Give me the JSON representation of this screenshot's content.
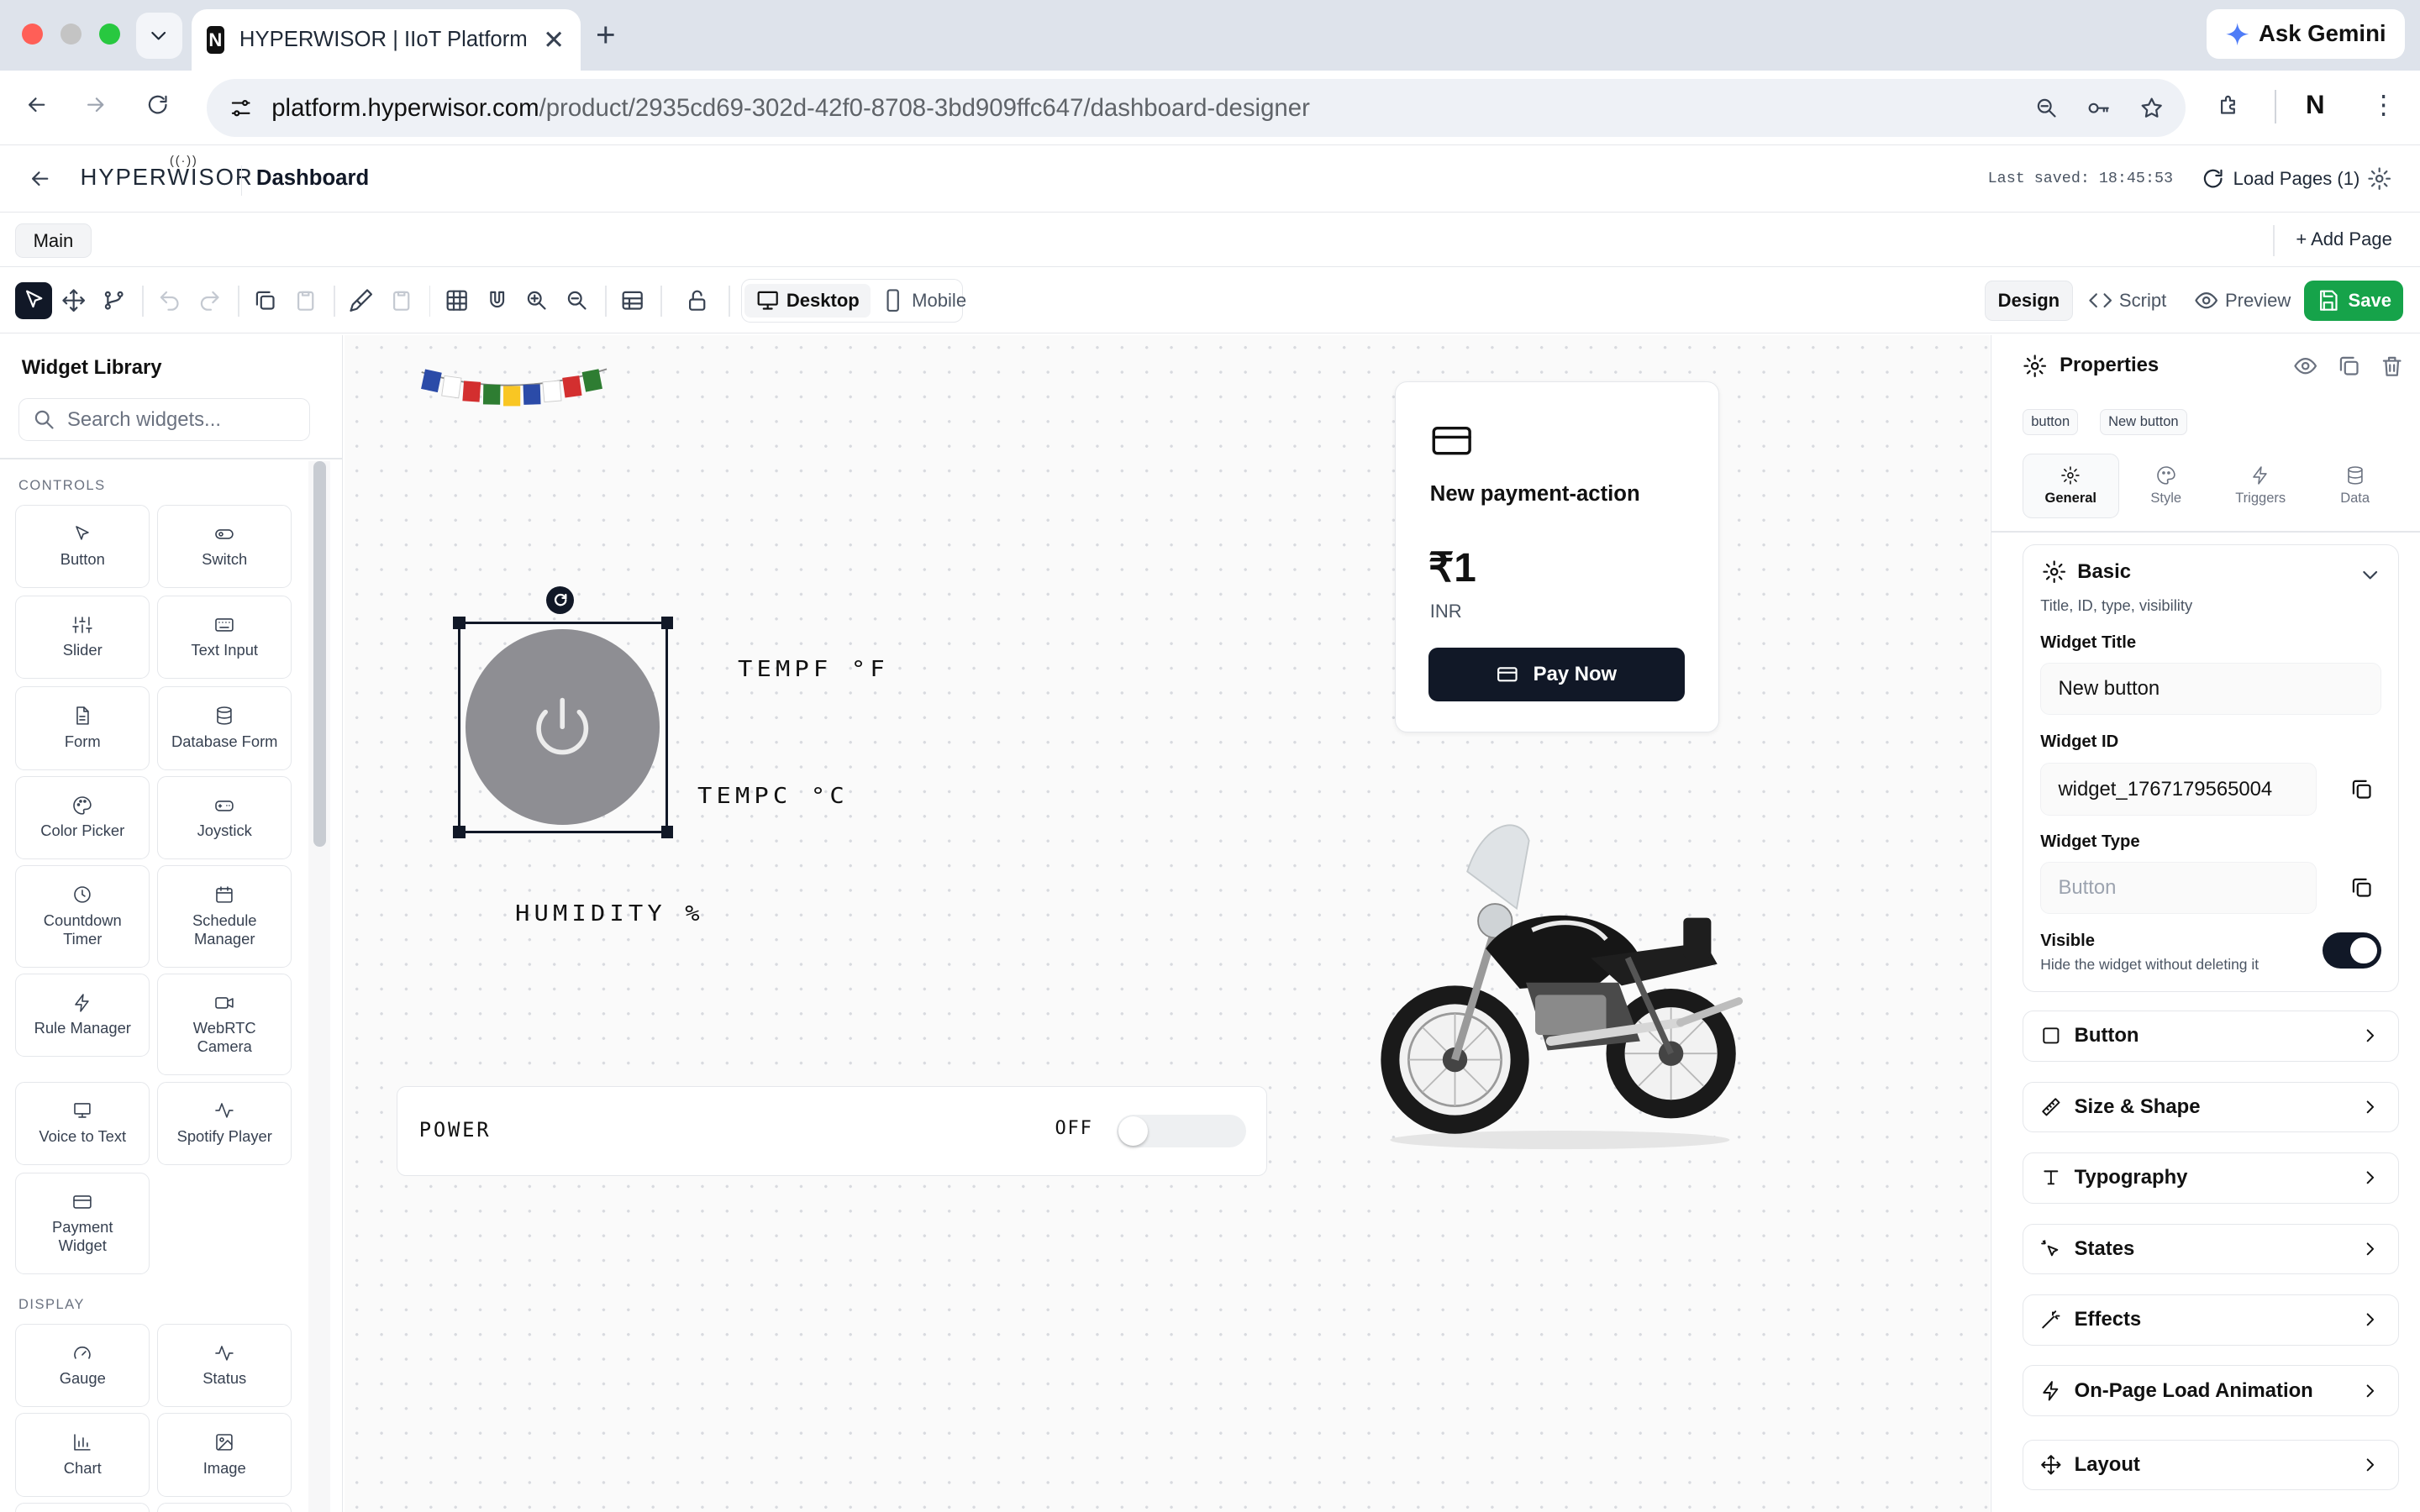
{
  "browser": {
    "tab_title": "HYPERWISOR | IIoT Platform",
    "tab_favicon_letter": "N",
    "url_host": "platform.hyperwisor.com",
    "url_path": "/product/2935cd69-302d-42f0-8708-3bd909ffc647/dashboard-designer",
    "gemini_label": "Ask Gemini",
    "traffic_colors": [
      "#ff5f57",
      "#c4c4c4",
      "#28c840"
    ]
  },
  "app": {
    "logo_text": "HYPERWISOR",
    "title": "Dashboard",
    "last_saved": "Last saved: 18:45:53",
    "load_pages": "Load Pages (1)",
    "page_tab": "Main",
    "add_page": "Add Page"
  },
  "toolbar": {
    "device_desktop": "Desktop",
    "device_mobile": "Mobile",
    "mode_design": "Design",
    "mode_script": "Script",
    "mode_preview": "Preview",
    "save": "Save",
    "save_color": "#16a34a"
  },
  "sidebar": {
    "title": "Widget Library",
    "search_placeholder": "Search widgets...",
    "sections": [
      {
        "name": "CONTROLS",
        "items": [
          {
            "label": "Button",
            "icon": "cursor-icon"
          },
          {
            "label": "Switch",
            "icon": "toggle-icon"
          },
          {
            "label": "Slider",
            "icon": "sliders-icon"
          },
          {
            "label": "Text Input",
            "icon": "keyboard-icon"
          },
          {
            "label": "Form",
            "icon": "file-icon"
          },
          {
            "label": "Database Form",
            "icon": "database-icon"
          },
          {
            "label": "Color Picker",
            "icon": "palette-icon"
          },
          {
            "label": "Joystick",
            "icon": "gamepad-icon"
          },
          {
            "label": "Countdown Timer",
            "icon": "clock-icon"
          },
          {
            "label": "Schedule Manager",
            "icon": "calendar-icon"
          },
          {
            "label": "Rule Manager",
            "icon": "zap-icon"
          },
          {
            "label": "WebRTC Camera",
            "icon": "video-icon"
          },
          {
            "label": "Voice to Text",
            "icon": "monitor-icon"
          },
          {
            "label": "Spotify Player",
            "icon": "activity-icon"
          },
          {
            "label": "Payment Widget",
            "icon": "credit-card-icon"
          }
        ]
      },
      {
        "name": "DISPLAY",
        "items": [
          {
            "label": "Gauge",
            "icon": "gauge-icon"
          },
          {
            "label": "Status",
            "icon": "activity-icon"
          },
          {
            "label": "Chart",
            "icon": "bar-chart-icon"
          },
          {
            "label": "Image",
            "icon": "image-icon"
          }
        ]
      }
    ]
  },
  "canvas": {
    "temp_f": "TEMPF °F",
    "temp_c": "TEMPC °C",
    "humidity": "HUMIDITY %",
    "power_label": "POWER",
    "power_state": "OFF",
    "payment": {
      "title": "New payment-action",
      "amount": "₹1",
      "currency": "INR",
      "button": "Pay Now"
    }
  },
  "properties": {
    "title": "Properties",
    "chip_type": "button",
    "chip_name": "New button",
    "tabs": [
      "General",
      "Style",
      "Triggers",
      "Data"
    ],
    "basic": {
      "title": "Basic",
      "subtitle": "Title, ID, type, visibility",
      "widget_title_label": "Widget Title",
      "widget_title_value": "New button",
      "widget_id_label": "Widget ID",
      "widget_id_value": "widget_1767179565004",
      "widget_type_label": "Widget Type",
      "widget_type_value": "Button",
      "visible_label": "Visible",
      "visible_hint": "Hide the widget without deleting it",
      "visible_on": true
    },
    "sections": [
      "Button",
      "Size & Shape",
      "Typography",
      "States",
      "Effects",
      "On-Page Load Animation",
      "Layout"
    ]
  }
}
